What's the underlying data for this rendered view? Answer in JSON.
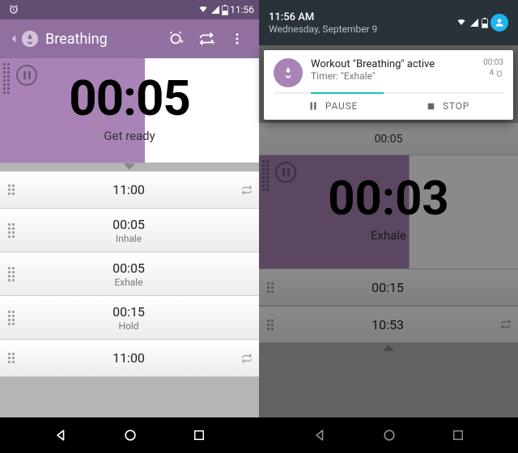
{
  "left": {
    "statusbar": {
      "time": "11:56"
    },
    "appbar": {
      "title": "Breathing"
    },
    "main": {
      "time": "00:05",
      "label": "Get ready"
    },
    "rows": [
      {
        "time": "11:00",
        "label": "",
        "repeat": true
      },
      {
        "time": "00:05",
        "label": "Inhale",
        "repeat": false
      },
      {
        "time": "00:05",
        "label": "Exhale",
        "repeat": false
      },
      {
        "time": "00:15",
        "label": "Hold",
        "repeat": false
      },
      {
        "time": "11:00",
        "label": "",
        "repeat": true
      }
    ]
  },
  "right": {
    "statusbar": {
      "time": "11:56 AM",
      "date": "Wednesday, September 9"
    },
    "notif": {
      "title": "Workout \"Breathing\" active",
      "sub": "Timer: \"Exhale\"",
      "elapsed": "00:03",
      "count": "4",
      "pause": "PAUSE",
      "stop": "STOP"
    },
    "under": {
      "preview": "00:05",
      "time": "00:03",
      "label": "Exhale",
      "rows": [
        {
          "time": "00:15",
          "label": ""
        },
        {
          "time": "10:53",
          "label": "",
          "repeat": true
        }
      ]
    }
  }
}
